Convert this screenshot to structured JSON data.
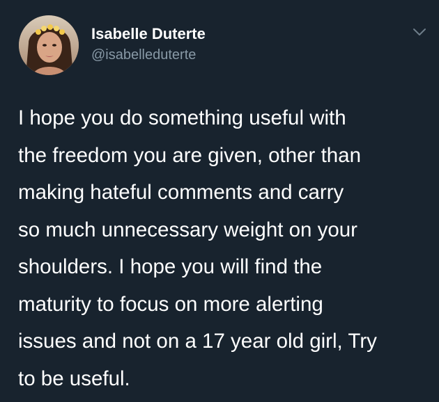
{
  "user": {
    "display_name": "Isabelle Duterte",
    "handle": "@isabelleduterte",
    "avatar_icon": "profile-photo"
  },
  "menu": {
    "icon": "chevron-down-icon"
  },
  "tweet": {
    "lines": [
      "I hope you do something useful with",
      "the freedom you are given, other than",
      "making hateful comments and carry",
      "so much unnecessary weight on your",
      "shoulders. I hope you will find the",
      "maturity to focus on more alerting",
      "issues and not on a 17 year old girl, Try",
      "to be useful."
    ]
  },
  "colors": {
    "background": "#18232e",
    "name": "#ffffff",
    "handle": "#8899a6",
    "text": "#ffffff"
  }
}
